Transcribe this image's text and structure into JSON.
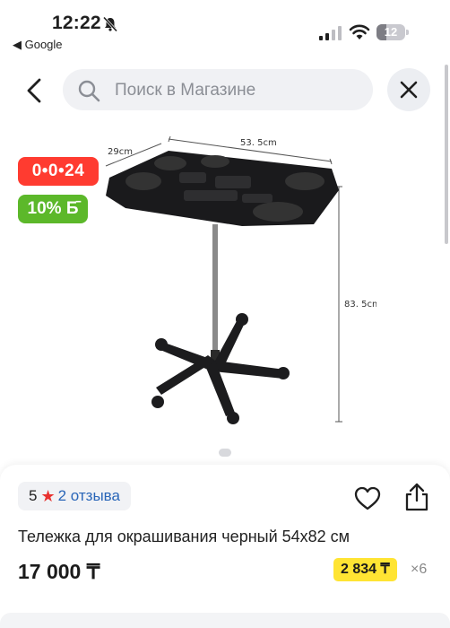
{
  "status": {
    "time": "12:22",
    "back_app": "◀ Google",
    "battery": "12"
  },
  "search": {
    "placeholder": "Поиск в Магазине"
  },
  "image": {
    "dim_width": "53. 5cm",
    "dim_depth": "29cm",
    "dim_height": "83. 5cm"
  },
  "badges": {
    "timer": "0•0•24",
    "discount": "10% Б̄"
  },
  "product": {
    "rating": "5",
    "reviews": "2 отзыва",
    "title": "Тележка для окрашивания черный 54x82 см",
    "price": "17 000 ₸",
    "installment": "2 834 ₸",
    "installment_mult": "×6"
  },
  "colors": {
    "timer_badge": "#ff3b30",
    "discount_badge": "#5cb82a",
    "installment": "#ffe433",
    "link": "#2a66b8"
  }
}
